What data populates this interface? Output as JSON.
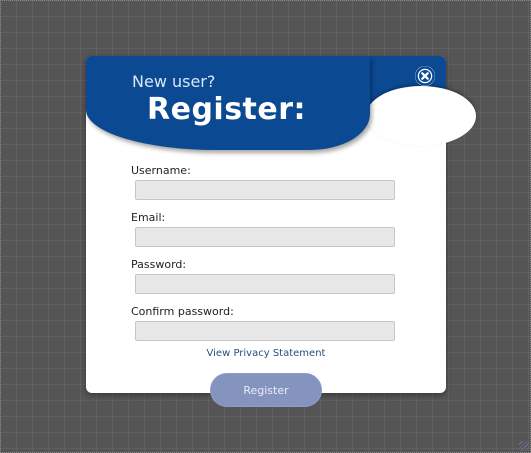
{
  "header": {
    "subtitle": "New user?",
    "title": "Register:",
    "close_icon": "close-circle-x-icon"
  },
  "form": {
    "fields": [
      {
        "label": "Username:",
        "value": ""
      },
      {
        "label": "Email:",
        "value": ""
      },
      {
        "label": "Password:",
        "value": ""
      },
      {
        "label": "Confirm password:",
        "value": ""
      }
    ],
    "privacy_link": "View Privacy Statement",
    "submit_label": "Register"
  },
  "colors": {
    "brand_blue": "#0b4a93",
    "background": "#555555",
    "input_bg": "#e8e8e8",
    "button_bg": "#8594bf"
  }
}
